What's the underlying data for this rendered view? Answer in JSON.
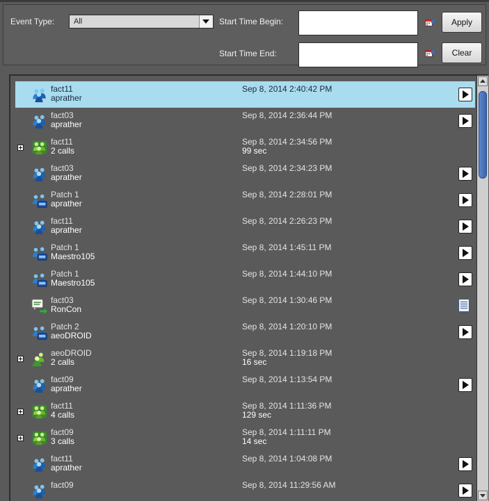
{
  "filters": {
    "event_type_label": "Event Type:",
    "event_type_value": "All",
    "start_begin_label": "Start Time Begin:",
    "start_begin_value": "",
    "start_end_label": "Start Time End:",
    "start_end_value": "",
    "apply_label": "Apply",
    "clear_label": "Clear"
  },
  "events": [
    {
      "name": "fact11",
      "sub": "aprather",
      "time": "Sep 8, 2014 2:40:42 PM",
      "duration": "",
      "icon": "group-call-icon",
      "action": "play",
      "expandable": false,
      "selected": true
    },
    {
      "name": "fact03",
      "sub": "aprather",
      "time": "Sep 8, 2014 2:36:44 PM",
      "duration": "",
      "icon": "group-call-icon",
      "action": "play",
      "expandable": false,
      "selected": false
    },
    {
      "name": "fact11",
      "sub": "2 calls",
      "time": "Sep 8, 2014 2:34:56 PM",
      "duration": "99 sec",
      "icon": "multi-call-icon",
      "action": "",
      "expandable": true,
      "selected": false
    },
    {
      "name": "fact03",
      "sub": "aprather",
      "time": "Sep 8, 2014 2:34:23 PM",
      "duration": "",
      "icon": "group-call-icon",
      "action": "play",
      "expandable": false,
      "selected": false
    },
    {
      "name": "Patch 1",
      "sub": "aprather",
      "time": "Sep 8, 2014 2:28:01 PM",
      "duration": "",
      "icon": "patch-call-icon",
      "action": "play",
      "expandable": false,
      "selected": false
    },
    {
      "name": "fact11",
      "sub": "aprather",
      "time": "Sep 8, 2014 2:26:23 PM",
      "duration": "",
      "icon": "group-call-icon",
      "action": "play",
      "expandable": false,
      "selected": false
    },
    {
      "name": "Patch 1",
      "sub": "Maestro105",
      "time": "Sep 8, 2014 1:45:11 PM",
      "duration": "",
      "icon": "patch-call-icon",
      "action": "play",
      "expandable": false,
      "selected": false
    },
    {
      "name": "Patch 1",
      "sub": "Maestro105",
      "time": "Sep 8, 2014 1:44:10 PM",
      "duration": "",
      "icon": "patch-call-icon",
      "action": "play",
      "expandable": false,
      "selected": false
    },
    {
      "name": "fact03",
      "sub": "RonCon",
      "time": "Sep 8, 2014 1:30:46 PM",
      "duration": "",
      "icon": "text-message-icon",
      "action": "document",
      "expandable": false,
      "selected": false
    },
    {
      "name": "Patch 2",
      "sub": "aeoDROID",
      "time": "Sep 8, 2014 1:20:10 PM",
      "duration": "",
      "icon": "patch-call-icon",
      "action": "play",
      "expandable": false,
      "selected": false
    },
    {
      "name": "aeoDROID",
      "sub": "2 calls",
      "time": "Sep 8, 2014 1:19:18 PM",
      "duration": "16 sec",
      "icon": "private-call-icon",
      "action": "",
      "expandable": true,
      "selected": false
    },
    {
      "name": "fact09",
      "sub": "aprather",
      "time": "Sep 8, 2014 1:13:54 PM",
      "duration": "",
      "icon": "group-call-icon",
      "action": "play",
      "expandable": false,
      "selected": false
    },
    {
      "name": "fact11",
      "sub": "4 calls",
      "time": "Sep 8, 2014 1:11:36 PM",
      "duration": "129 sec",
      "icon": "multi-call-icon",
      "action": "",
      "expandable": true,
      "selected": false
    },
    {
      "name": "fact09",
      "sub": "3 calls",
      "time": "Sep 8, 2014 1:11:11 PM",
      "duration": "14 sec",
      "icon": "multi-call-icon",
      "action": "",
      "expandable": true,
      "selected": false
    },
    {
      "name": "fact11",
      "sub": "aprather",
      "time": "Sep 8, 2014 1:04:08 PM",
      "duration": "",
      "icon": "group-call-icon",
      "action": "play",
      "expandable": false,
      "selected": false
    },
    {
      "name": "fact09",
      "sub": "",
      "time": "Sep 8, 2014 11:29:56 AM",
      "duration": "",
      "icon": "group-call-icon",
      "action": "play",
      "expandable": false,
      "selected": false
    }
  ]
}
